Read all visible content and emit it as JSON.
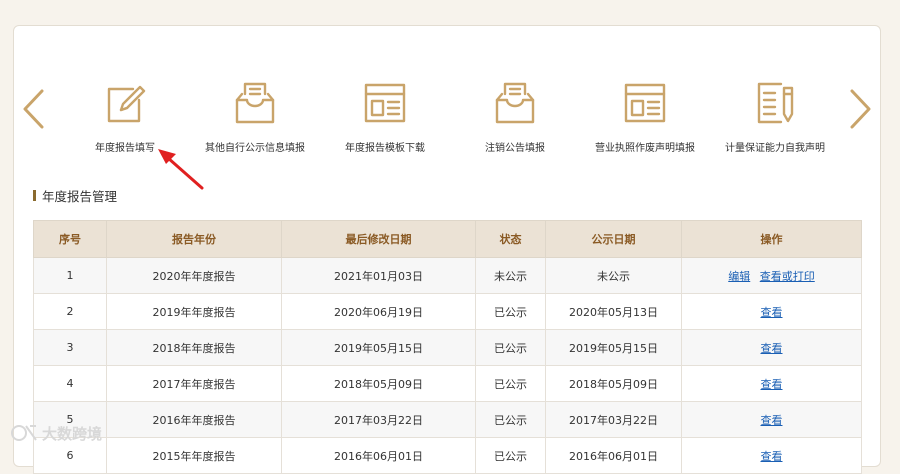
{
  "colors": {
    "accent": "#c9a46a",
    "header_bg": "#ebe2d5",
    "header_text": "#8a5a24",
    "link": "#1a5fb4",
    "annotation_arrow": "#e02020"
  },
  "nav": {
    "prev_icon": "chevron-left-icon",
    "next_icon": "chevron-right-icon"
  },
  "menu": [
    {
      "label": "年度报告填写",
      "icon": "edit-form-icon"
    },
    {
      "label": "其他自行公示信息填报",
      "icon": "inbox-tray-icon"
    },
    {
      "label": "年度报告模板下载",
      "icon": "template-window-icon"
    },
    {
      "label": "注销公告填报",
      "icon": "inbox-tray-icon"
    },
    {
      "label": "营业执照作废声明填报",
      "icon": "template-window-icon"
    },
    {
      "label": "计量保证能力自我声明",
      "icon": "document-pen-icon"
    }
  ],
  "section": {
    "title": "年度报告管理"
  },
  "table": {
    "headers": [
      "序号",
      "报告年份",
      "最后修改日期",
      "状态",
      "公示日期",
      "操作"
    ],
    "rows": [
      {
        "no": "1",
        "year": "2020年年度报告",
        "modified": "2021年01月03日",
        "status": "未公示",
        "publish": "未公示",
        "actions": [
          "编辑",
          "查看或打印"
        ]
      },
      {
        "no": "2",
        "year": "2019年年度报告",
        "modified": "2020年06月19日",
        "status": "已公示",
        "publish": "2020年05月13日",
        "actions": [
          "查看"
        ]
      },
      {
        "no": "3",
        "year": "2018年年度报告",
        "modified": "2019年05月15日",
        "status": "已公示",
        "publish": "2019年05月15日",
        "actions": [
          "查看"
        ]
      },
      {
        "no": "4",
        "year": "2017年年度报告",
        "modified": "2018年05月09日",
        "status": "已公示",
        "publish": "2018年05月09日",
        "actions": [
          "查看"
        ]
      },
      {
        "no": "5",
        "year": "2016年年度报告",
        "modified": "2017年03月22日",
        "status": "已公示",
        "publish": "2017年03月22日",
        "actions": [
          "查看"
        ]
      },
      {
        "no": "6",
        "year": "2015年年度报告",
        "modified": "2016年06月01日",
        "status": "已公示",
        "publish": "2016年06月01日",
        "actions": [
          "查看"
        ]
      }
    ]
  },
  "watermark": {
    "text": "大数跨境"
  }
}
